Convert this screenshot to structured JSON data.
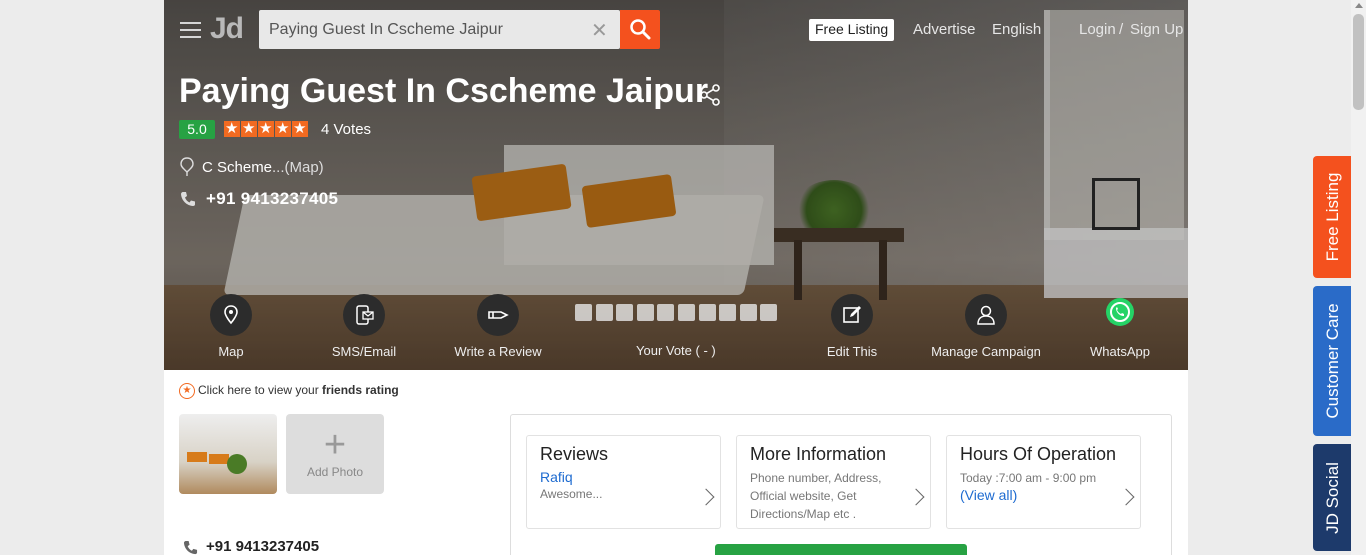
{
  "header": {
    "logo": "Jd",
    "search_value": "Paying Guest In Cscheme Jaipur",
    "free_listing": "Free Listing",
    "advertise": "Advertise",
    "language": "English",
    "login": "Login",
    "separator": "/",
    "signup": "Sign Up"
  },
  "listing": {
    "title": "Paying Guest In Cscheme Jaipur",
    "rating": "5.0",
    "stars": 5,
    "votes": "4 Votes",
    "location": "C Scheme",
    "map_link": "...(Map)",
    "phone": "+91 9413237405"
  },
  "actions": [
    {
      "label": "Map",
      "icon": "map-pin-icon"
    },
    {
      "label": "SMS/Email",
      "icon": "sms-email-icon"
    },
    {
      "label": "Write a Review",
      "icon": "pen-icon"
    },
    {
      "label": "Edit This",
      "icon": "edit-icon"
    },
    {
      "label": "Manage Campaign",
      "icon": "person-icon"
    },
    {
      "label": "WhatsApp",
      "icon": "whatsapp-icon"
    }
  ],
  "vote": {
    "label": "Your Vote ( - )",
    "boxes": 10
  },
  "friends": {
    "prefix": "Click here to view your ",
    "bold": "friends rating"
  },
  "photos": {
    "add_label": "Add Photo",
    "add_glyph": "+"
  },
  "lower_phone": "+91 9413237405",
  "cards": {
    "reviews": {
      "title": "Reviews",
      "reviewer": "Rafiq",
      "snippet": "Awesome..."
    },
    "more_info": {
      "title": "More Information",
      "text": "Phone number, Address, Official website, Get Directions/Map etc ."
    },
    "hours": {
      "title": "Hours Of Operation",
      "today": "Today :7:00 am - 9:00 pm",
      "view_all": "(View all)"
    }
  },
  "side_tabs": {
    "free_listing": "Free Listing",
    "customer_care": "Customer Care",
    "jd_social": "JD Social"
  },
  "colors": {
    "accent": "#f4511e",
    "green": "#27a243",
    "orange_tab": "#f4511e",
    "blue_tab": "#2a6bc8",
    "navy_tab": "#1d3a6b"
  }
}
